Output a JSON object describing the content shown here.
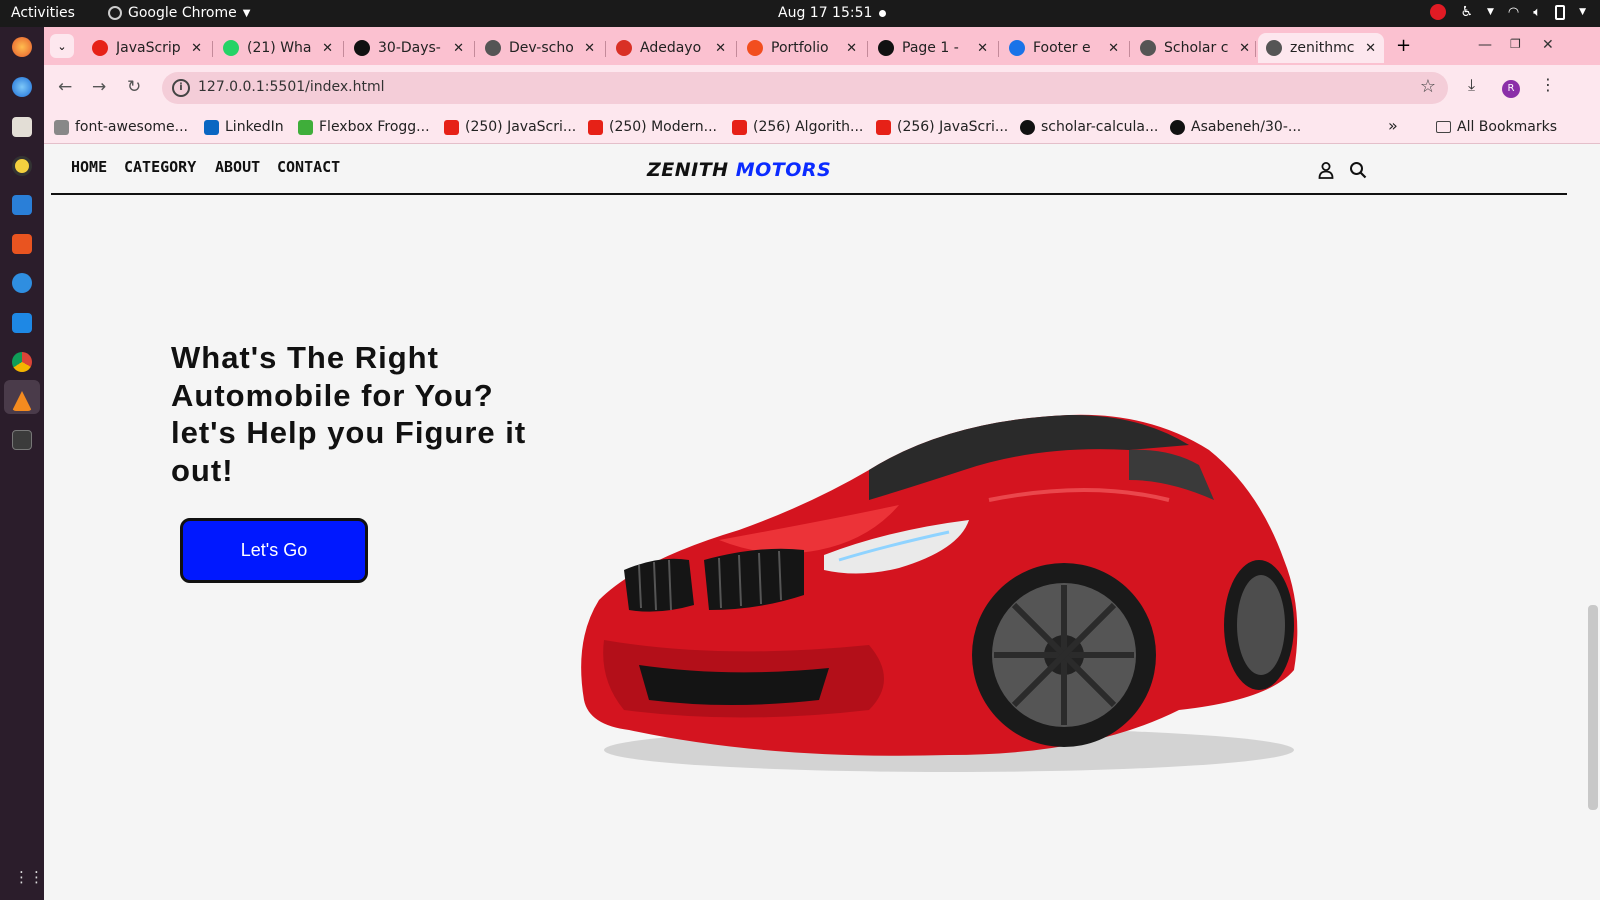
{
  "topbar": {
    "activities": "Activities",
    "app_name": "Google Chrome",
    "clock": "Aug 17  15:51"
  },
  "tabs": [
    {
      "label": "JavaScrip",
      "favicon": "youtube-icon",
      "color": "#e62117"
    },
    {
      "label": "(21) Wha",
      "favicon": "whatsapp-icon",
      "color": "#25d366"
    },
    {
      "label": "30-Days-",
      "favicon": "github-icon",
      "color": "#111111"
    },
    {
      "label": "Dev-scho",
      "favicon": "globe-icon",
      "color": "#555555"
    },
    {
      "label": "Adedayo",
      "favicon": "gmail-icon",
      "color": "#d93025"
    },
    {
      "label": "Portfolio",
      "favicon": "figma-icon",
      "color": "#f24e1e"
    },
    {
      "label": "Page 1 -",
      "favicon": "play-icon",
      "color": "#111111"
    },
    {
      "label": "Footer e",
      "favicon": "forms-icon",
      "color": "#1a73e8"
    },
    {
      "label": "Scholar c",
      "favicon": "globe-icon",
      "color": "#555555"
    },
    {
      "label": "zenithmc",
      "favicon": "globe-icon",
      "color": "#555555",
      "active": true
    }
  ],
  "address_bar": {
    "url": "127.0.0.1:5501/index.html"
  },
  "bookmarks": [
    {
      "label": "font-awesome...",
      "icon": "code-icon"
    },
    {
      "label": "LinkedIn",
      "icon": "linkedin-icon"
    },
    {
      "label": "Flexbox Frogg...",
      "icon": "frog-icon"
    },
    {
      "label": "(250) JavaScri...",
      "icon": "youtube-icon"
    },
    {
      "label": "(250) Modern...",
      "icon": "youtube-icon"
    },
    {
      "label": "(256) Algorith...",
      "icon": "youtube-icon"
    },
    {
      "label": "(256) JavaScri...",
      "icon": "youtube-icon"
    },
    {
      "label": "scholar-calcula...",
      "icon": "vercel-icon"
    },
    {
      "label": "Asabeneh/30-...",
      "icon": "github-icon"
    }
  ],
  "bookmarks_more": "»",
  "all_bookmarks": "All Bookmarks",
  "profile_initial": "R",
  "site": {
    "nav": [
      "HOME",
      "CATEGORY",
      "ABOUT",
      "CONTACT"
    ],
    "brand_part1": "ZENITH",
    "brand_part2": "MOTORS",
    "hero_title": "What's The Right Automobile for You? let's Help you Figure it out!",
    "cta_label": "Let's Go",
    "colors": {
      "accent": "#0018ff",
      "brand_blue": "#0b2bff",
      "car_red": "#d4141f"
    }
  }
}
